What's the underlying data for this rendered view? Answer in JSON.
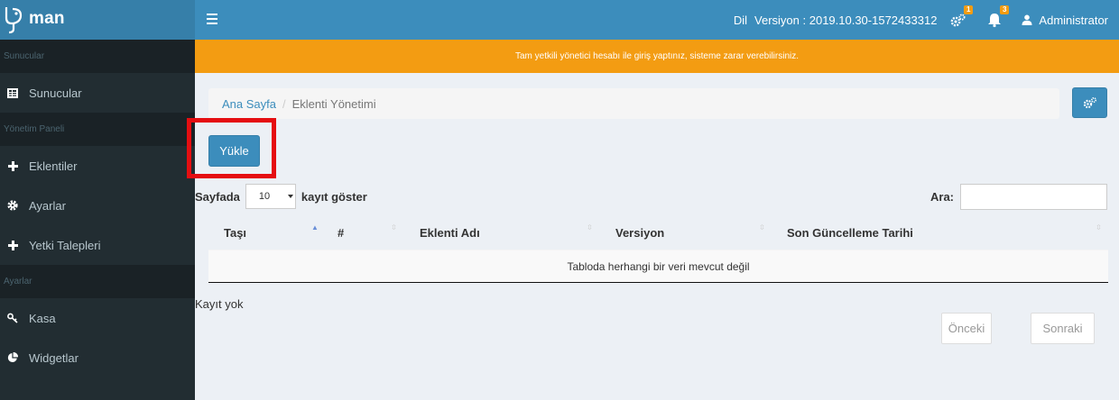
{
  "app": {
    "logo_text": "man"
  },
  "header": {
    "language": "Dil",
    "version": "Versiyon : 2019.10.30-1572433312",
    "cogs_badge": "1",
    "bell_badge": "3",
    "user": "Administrator"
  },
  "sidebar": {
    "groups": [
      {
        "label": "Sunucular",
        "items": [
          {
            "label": "Sunucular",
            "icon": "server-icon"
          }
        ]
      },
      {
        "label": "Yönetim Paneli",
        "items": [
          {
            "label": "Eklentiler",
            "icon": "plus-icon"
          },
          {
            "label": "Ayarlar",
            "icon": "gear-icon"
          },
          {
            "label": "Yetki Talepleri",
            "icon": "plus-icon"
          }
        ]
      },
      {
        "label": "Ayarlar",
        "items": [
          {
            "label": "Kasa",
            "icon": "key-icon"
          },
          {
            "label": "Widgetlar",
            "icon": "pie-chart-icon"
          }
        ]
      }
    ]
  },
  "alert": "Tam yetkili yönetici hesabı ile giriş yaptınız, sisteme zarar verebilirsiniz.",
  "breadcrumb": {
    "home": "Ana Sayfa",
    "separator": "/",
    "current": "Eklenti Yönetimi"
  },
  "upload_label": "Yükle",
  "table_controls": {
    "length_prefix": "Sayfada",
    "length_value": "10",
    "length_suffix": "kayıt göster",
    "search_label": "Ara:",
    "search_value": ""
  },
  "table": {
    "columns": [
      "Taşı",
      "#",
      "Eklenti Adı",
      "Versiyon",
      "Son Güncelleme Tarihi"
    ],
    "empty_message": "Tabloda herhangi bir veri mevcut değil"
  },
  "info": "Kayıt yok",
  "pagination": {
    "prev": "Önceki",
    "next": "Sonraki"
  },
  "colors": {
    "primary": "#3c8dbc",
    "warning": "#f39c12",
    "sidebar": "#222d32",
    "highlight": "#e50e11"
  }
}
